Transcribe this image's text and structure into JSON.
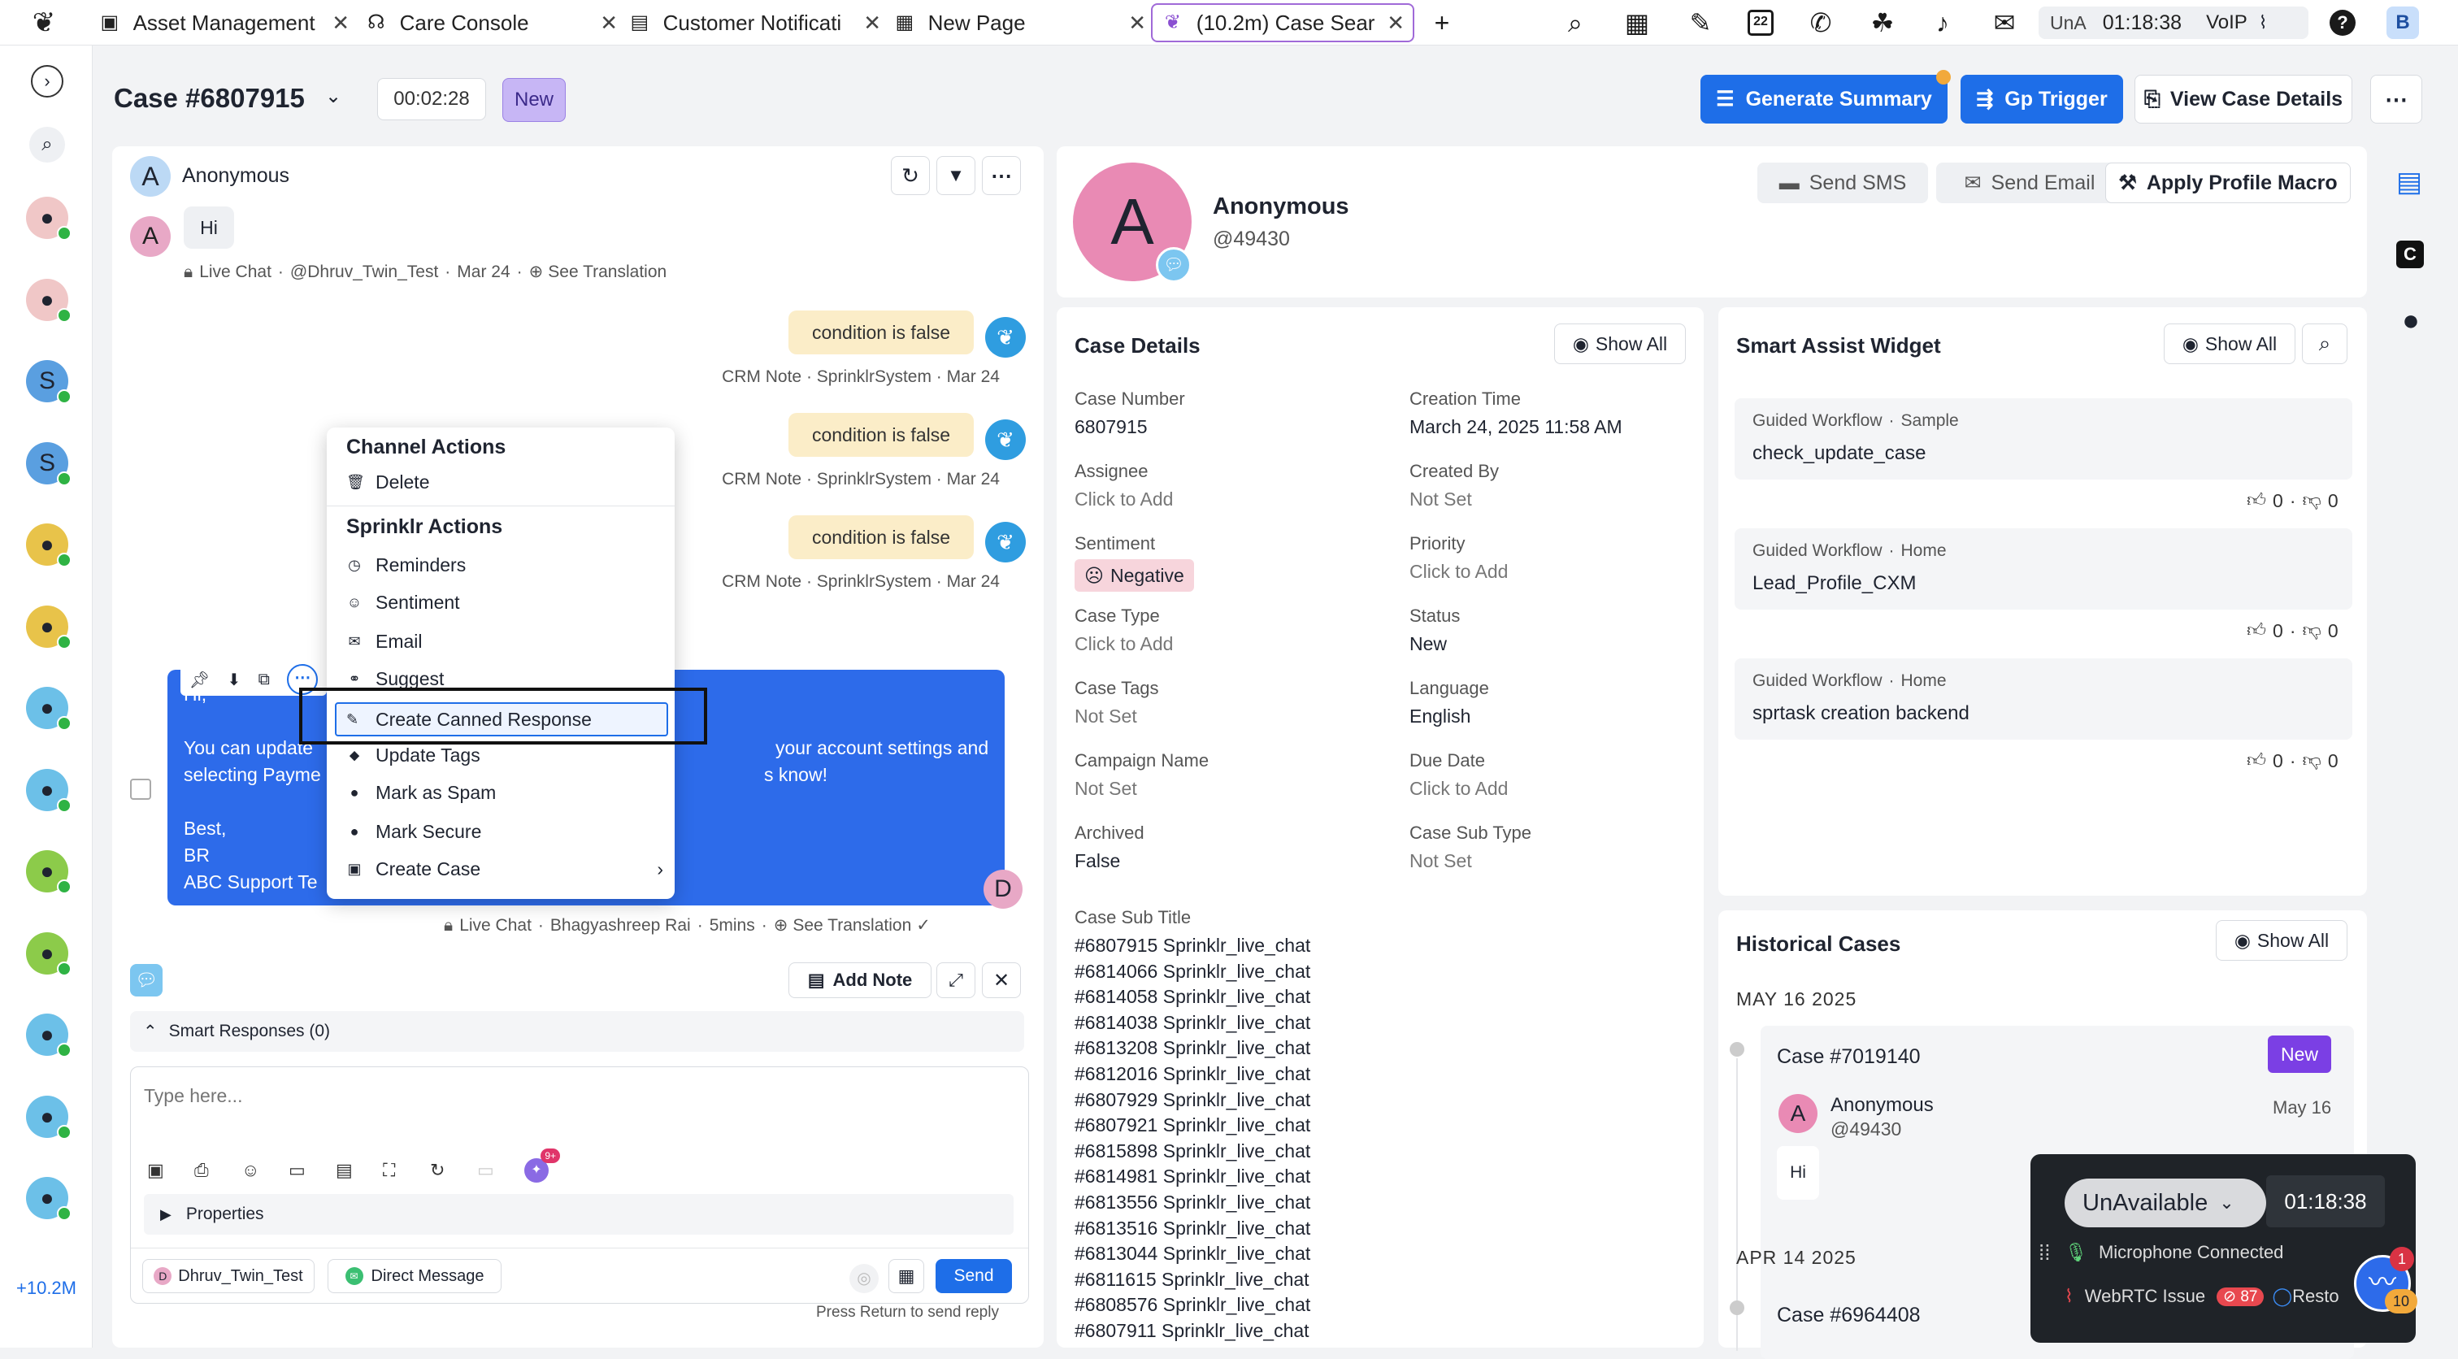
{
  "tabs": [
    {
      "label": "Asset Management",
      "icon": "briefcase-icon"
    },
    {
      "label": "Care Console",
      "icon": "headset-icon"
    },
    {
      "label": "Customer Notificati",
      "icon": "chat-icon"
    },
    {
      "label": "New Page",
      "icon": "grid-icon"
    },
    {
      "label": "(10.2m) Case Sear",
      "icon": "sprinklr-icon"
    }
  ],
  "topbar": {
    "status": "UnA",
    "time": "01:18:38",
    "voip": "VoIP",
    "user_initial": "B",
    "calendar_day": "22"
  },
  "rail": {
    "count": "+10.2M",
    "initials": [
      "",
      "",
      "S",
      "S",
      "",
      "",
      "",
      "",
      "",
      "",
      "",
      "",
      ""
    ]
  },
  "case": {
    "title": "Case #6807915",
    "timer": "00:02:28",
    "badge": "New"
  },
  "header_buttons": {
    "generate": "Generate Summary",
    "gp": "Gp Trigger",
    "view": "View Case Details"
  },
  "conversation": {
    "name": "Anonymous",
    "avatar": "A",
    "msg_hi": "Hi",
    "meta1": {
      "channel": "Live Chat",
      "handle": "@Dhruv_Twin_Test",
      "date": "Mar 24",
      "translate": "See Translation"
    },
    "notes": [
      {
        "text": "condition is false",
        "meta": "CRM Note · SprinklrSystem · Mar 24"
      },
      {
        "text": "condition is false",
        "meta": "CRM Note · SprinklrSystem · Mar 24"
      },
      {
        "text": "condition is false",
        "meta": "CRM Note · SprinklrSystem · Mar 24"
      }
    ],
    "reply_lines": [
      "Hi,",
      "",
      "You can update",
      "selecting Payme",
      "",
      "Best,",
      "BR",
      "ABC Support Te"
    ],
    "reply_tail": [
      "your account settings and",
      "s know!"
    ],
    "reply_meta": {
      "channel": "Live Chat",
      "agent": "Bhagyashreep Rai",
      "ago": "5mins",
      "translate": "See Translation"
    },
    "agent_initial": "D"
  },
  "context_menu": {
    "section1": "Channel Actions",
    "delete": "Delete",
    "section2": "Sprinklr Actions",
    "items": [
      "Reminders",
      "Sentiment",
      "Email",
      "Suggest",
      "Create Canned Response",
      "Update Tags",
      "Mark as Spam",
      "Mark Secure",
      "Create Case"
    ]
  },
  "composer": {
    "add_note": "Add Note",
    "smart_responses": "Smart Responses (0)",
    "placeholder": "Type here...",
    "properties": "Properties",
    "account": "Dhruv_Twin_Test",
    "channel": "Direct Message",
    "send": "Send",
    "hint": "Press Return to send reply",
    "badge": "9+"
  },
  "profile": {
    "initial": "A",
    "name": "Anonymous",
    "id": "@49430",
    "send_sms": "Send SMS",
    "send_email": "Send Email",
    "apply_macro": "Apply Profile Macro"
  },
  "case_details": {
    "title": "Case Details",
    "show_all": "Show All",
    "left": [
      {
        "label": "Case Number",
        "value": "6807915"
      },
      {
        "label": "Assignee",
        "value": "Click to Add"
      },
      {
        "label": "Sentiment",
        "value": "Negative"
      },
      {
        "label": "Case Type",
        "value": "Click to Add"
      },
      {
        "label": "Case Tags",
        "value": "Not Set"
      },
      {
        "label": "Campaign Name",
        "value": "Not Set"
      },
      {
        "label": "Archived",
        "value": "False"
      }
    ],
    "right": [
      {
        "label": "Creation Time",
        "value": "March 24, 2025 11:58 AM"
      },
      {
        "label": "Created By",
        "value": "Not Set"
      },
      {
        "label": "Priority",
        "value": "Click to Add"
      },
      {
        "label": "Status",
        "value": "New"
      },
      {
        "label": "Language",
        "value": "English"
      },
      {
        "label": "Due Date",
        "value": "Click to Add"
      },
      {
        "label": "Case Sub Type",
        "value": "Not Set"
      }
    ],
    "subtitle_label": "Case Sub Title",
    "subtitles": [
      "#6807915 Sprinklr_live_chat",
      "#6814066 Sprinklr_live_chat",
      "#6814058 Sprinklr_live_chat",
      "#6814038 Sprinklr_live_chat",
      "#6813208 Sprinklr_live_chat",
      "#6812016 Sprinklr_live_chat",
      "#6807929 Sprinklr_live_chat",
      "#6807921 Sprinklr_live_chat",
      "#6815898 Sprinklr_live_chat",
      "#6814981 Sprinklr_live_chat",
      "#6813556 Sprinklr_live_chat",
      "#6813516 Sprinklr_live_chat",
      "#6813044 Sprinklr_live_chat",
      "#6811615 Sprinklr_live_chat",
      "#6808576 Sprinklr_live_chat",
      "#6807911 Sprinklr_live_chat"
    ]
  },
  "smart_assist": {
    "title": "Smart Assist Widget",
    "show_all": "Show All",
    "cards": [
      {
        "type": "Guided Workflow",
        "cat": "Sample",
        "name": "check_update_case",
        "up": "0",
        "down": "0"
      },
      {
        "type": "Guided Workflow",
        "cat": "Home",
        "name": "Lead_Profile_CXM",
        "up": "0",
        "down": "0"
      },
      {
        "type": "Guided Workflow",
        "cat": "Home",
        "name": "sprtask creation backend",
        "up": "0",
        "down": "0"
      }
    ]
  },
  "historical": {
    "title": "Historical Cases",
    "show_all": "Show All",
    "date1": "MAY 16 2025",
    "case1": "Case #7019140",
    "badge1": "New",
    "person": "Anonymous",
    "person_id": "@49430",
    "person_date": "May 16",
    "msg": "Hi",
    "date2": "APR 14 2025",
    "case2": "Case #6964408"
  },
  "voice": {
    "status": "UnAvailable",
    "time": "01:18:38",
    "mic": "Microphone Connected",
    "webrtc": "WebRTC Issue",
    "issue_count": "87",
    "restore": "Resto",
    "n1": "1",
    "n2": "10"
  }
}
